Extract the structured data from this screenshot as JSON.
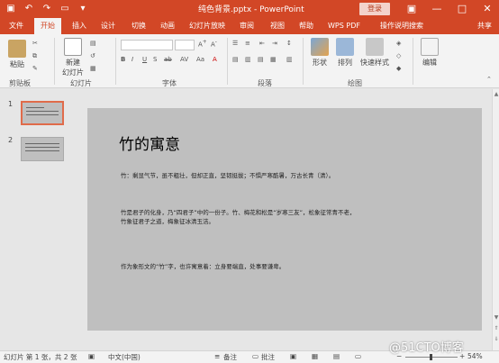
{
  "titlebar": {
    "title": "纯色背景.pptx  -  PowerPoint",
    "login": "登录",
    "qat_icons": [
      "save-icon",
      "undo-icon",
      "redo-icon",
      "start-slideshow-icon",
      "customize-qat-icon"
    ]
  },
  "tabs": [
    "文件",
    "开始",
    "插入",
    "设计",
    "切换",
    "动画",
    "幻灯片放映",
    "审阅",
    "视图",
    "帮助",
    "WPS PDF",
    "操作说明搜索"
  ],
  "share_label": "共享",
  "ribbon": {
    "clipboard": {
      "paste": "粘贴",
      "group": "剪贴板"
    },
    "slides": {
      "new_slide": "新建",
      "new_slide2": "幻灯片",
      "group": "幻灯片"
    },
    "font": {
      "group": "字体"
    },
    "paragraph": {
      "group": "段落"
    },
    "drawing": {
      "shapes": "形状",
      "arrange": "排列",
      "quick_styles": "快速样式",
      "group": "绘图"
    },
    "editing": {
      "edit": "编辑"
    }
  },
  "slides_panel": [
    {
      "number": "1",
      "selected": true
    },
    {
      "number": "2",
      "selected": false
    }
  ],
  "slide": {
    "title": "竹的寓意",
    "para1": "竹：剩显气节，虽不粗壮，但却正直，坚韧挺拔；不惧严寒酷暑，万古长青（清）。",
    "para2a": "竹是君子的化身，乃“四君子”中的一份子。竹、梅花和松是“岁寒三友”，松象征常青不老，",
    "para2b": "竹象征君子之道，梅象征冰清玉洁。",
    "para3": "作为象形文的“竹”字，也许寓意着：立身要端直，处事要谦卑。"
  },
  "status": {
    "slide_info": "幻灯片 第 1 张，共 2 张",
    "language": "中文(中国)",
    "notes": "备注",
    "comments": "批注",
    "zoom": "54%"
  },
  "watermark": "@51CTO博客",
  "colors": {
    "accent": "#d24726",
    "slide_bg": "#bfbfbf",
    "selected_thumb": "#e06b4a"
  }
}
